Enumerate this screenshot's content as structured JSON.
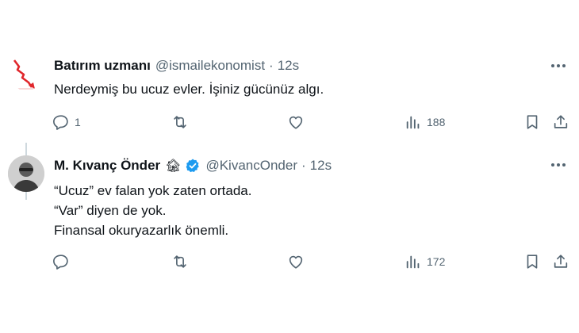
{
  "tweets": [
    {
      "author_name": "Batırım uzmanı",
      "handle": "@ismailekonomist",
      "separator": "·",
      "time": "12s",
      "text_lines": [
        "Nerdeymiş bu ucuz evler. İşiniz gücünüz algı."
      ],
      "reply_count": "1",
      "retweet_count": "",
      "like_count": "",
      "view_count": "188"
    },
    {
      "author_name": "M. Kıvanç Önder",
      "name_emoji": "🏚",
      "verified": true,
      "handle": "@KivancOnder",
      "separator": "·",
      "time": "12s",
      "text_lines": [
        "“Ucuz” ev falan yok zaten ortada.",
        "“Var” diyen de yok.",
        "Finansal okuryazarlık önemli."
      ],
      "reply_count": "",
      "retweet_count": "",
      "like_count": "",
      "view_count": "172"
    }
  ],
  "colors": {
    "text": "#0f1419",
    "secondary": "#536471",
    "verified": "#1d9bf0",
    "thread_line": "#cfd9de"
  }
}
